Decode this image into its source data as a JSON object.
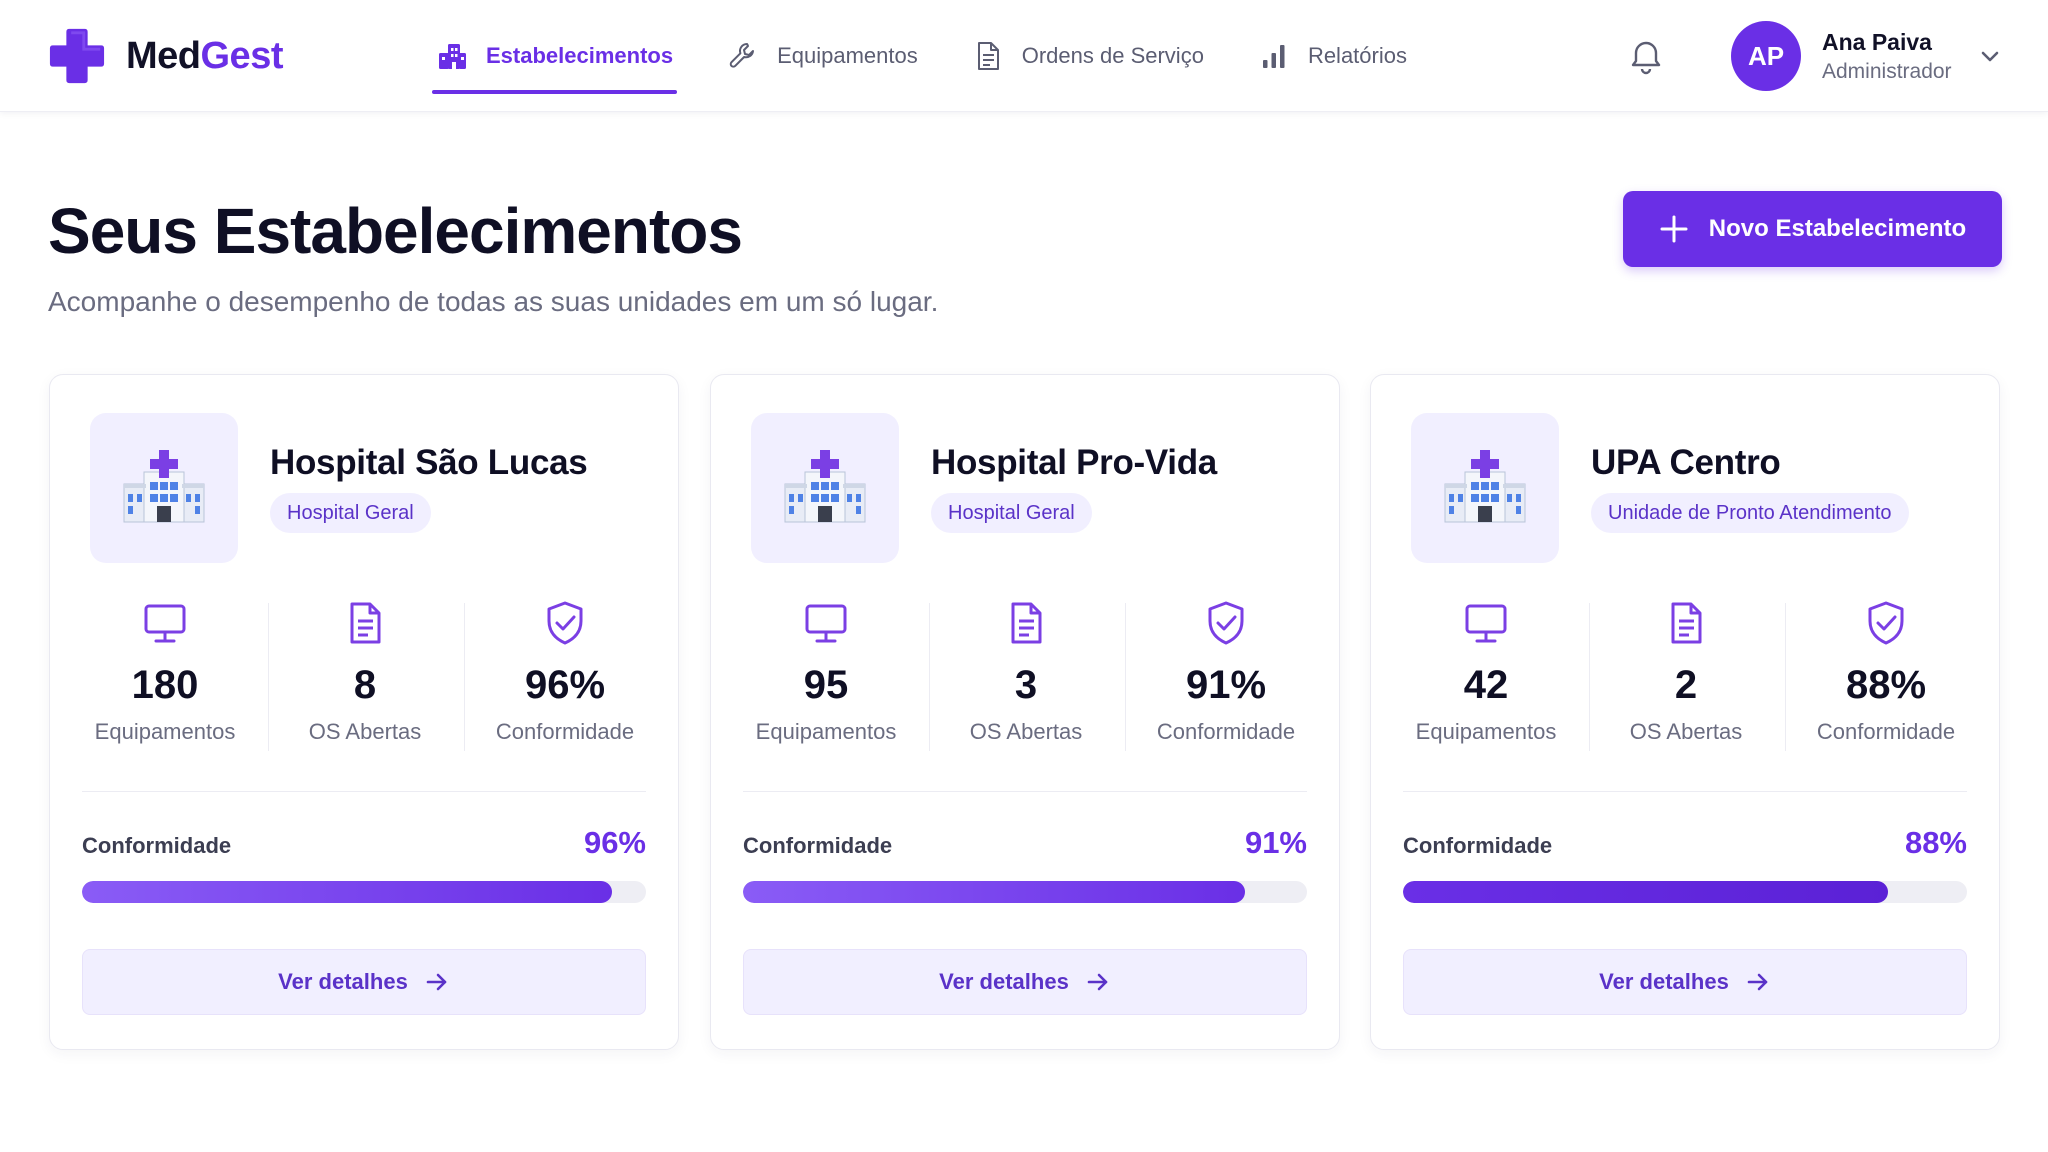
{
  "brand": {
    "name_part1": "Med",
    "name_part2": "Gest"
  },
  "nav": {
    "items": [
      {
        "label": "Estabelecimentos",
        "icon": "buildings-icon",
        "active": true
      },
      {
        "label": "Equipamentos",
        "icon": "wrench-icon",
        "active": false
      },
      {
        "label": "Ordens de Serviço",
        "icon": "document-icon",
        "active": false
      },
      {
        "label": "Relatórios",
        "icon": "bar-chart-icon",
        "active": false
      }
    ]
  },
  "user": {
    "initials": "AP",
    "name": "Ana Paiva",
    "role": "Administrador"
  },
  "header": {
    "title": "Seus Estabelecimentos",
    "subtitle": "Acompanhe o desempenho de todas as suas unidades em um só lugar.",
    "new_button_label": "Novo Estabelecimento"
  },
  "colors": {
    "accent": "#6a2fe6",
    "accent_light": "#f1efff",
    "progress_gradients": [
      [
        "#8a5cf6",
        "#6a2fe6"
      ],
      [
        "#8a5cf6",
        "#6a2fe6"
      ],
      [
        "#6a2fe6",
        "#5b21d6"
      ]
    ]
  },
  "cards": [
    {
      "name": "Hospital São Lucas",
      "type": "Hospital Geral",
      "icon": "hospital-icon",
      "stats": [
        {
          "value": "180",
          "label": "Equipamentos",
          "icon": "monitor-icon"
        },
        {
          "value": "8",
          "label": "OS Abertas",
          "icon": "document-icon"
        },
        {
          "value": "96%",
          "label": "Conformidade",
          "icon": "shield-check-icon"
        }
      ],
      "conformity_label": "Conformidade",
      "conformity_value": "96%",
      "conformity_fraction": 0.94,
      "details_label": "Ver detalhes"
    },
    {
      "name": "Hospital Pro-Vida",
      "type": "Hospital Geral",
      "icon": "hospital-icon",
      "stats": [
        {
          "value": "95",
          "label": "Equipamentos",
          "icon": "monitor-icon"
        },
        {
          "value": "3",
          "label": "OS Abertas",
          "icon": "document-icon"
        },
        {
          "value": "91%",
          "label": "Conformidade",
          "icon": "shield-check-icon"
        }
      ],
      "conformity_label": "Conformidade",
      "conformity_value": "91%",
      "conformity_fraction": 0.89,
      "details_label": "Ver detalhes"
    },
    {
      "name": "UPA Centro",
      "type": "Unidade de Pronto Atendimento",
      "icon": "hospital-icon",
      "stats": [
        {
          "value": "42",
          "label": "Equipamentos",
          "icon": "monitor-icon"
        },
        {
          "value": "2",
          "label": "OS Abertas",
          "icon": "document-icon"
        },
        {
          "value": "88%",
          "label": "Conformidade",
          "icon": "shield-check-icon"
        }
      ],
      "conformity_label": "Conformidade",
      "conformity_value": "88%",
      "conformity_fraction": 0.86,
      "details_label": "Ver detalhes"
    }
  ]
}
